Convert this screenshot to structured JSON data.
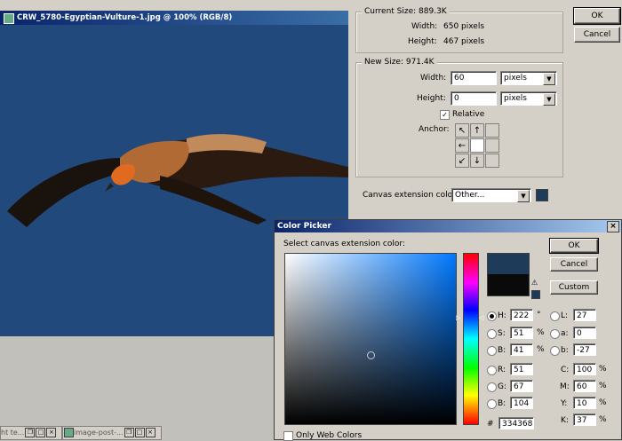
{
  "image_window": {
    "title": "CRW_5780-Egyptian-Vulture-1.jpg @ 100% (RGB/8)"
  },
  "canvas_size": {
    "current_size": "Current Size: 889.3K",
    "width_label": "Width:",
    "width_value": "650 pixels",
    "height_label": "Height:",
    "height_value": "467 pixels",
    "new_size": "New Size: 971.4K",
    "new_width": "60",
    "new_height": "0",
    "width_unit": "pixels",
    "height_unit": "pixels",
    "relative_label": "Relative",
    "relative_checked": true,
    "anchor_label": "Anchor:",
    "ext_color_label": "Canvas extension color:",
    "ext_color_value": "Other...",
    "ext_color_swatch": "#1f3b5a",
    "ok": "OK",
    "cancel": "Cancel"
  },
  "color_picker": {
    "title": "Color Picker",
    "prompt": "Select canvas extension color:",
    "ok": "OK",
    "cancel": "Cancel",
    "custom": "Custom",
    "new_color": "#1f3b5a",
    "old_color": "#0a0a0a",
    "H": {
      "label": "H:",
      "value": "222",
      "unit": "°"
    },
    "S": {
      "label": "S:",
      "value": "51",
      "unit": "%"
    },
    "Bv": {
      "label": "B:",
      "value": "41",
      "unit": "%"
    },
    "R": {
      "label": "R:",
      "value": "51"
    },
    "G": {
      "label": "G:",
      "value": "67"
    },
    "Bc": {
      "label": "B:",
      "value": "104"
    },
    "L": {
      "label": "L:",
      "value": "27"
    },
    "a": {
      "label": "a:",
      "value": "0"
    },
    "b": {
      "label": "b:",
      "value": "-27"
    },
    "C": {
      "label": "C:",
      "value": "100",
      "unit": "%"
    },
    "M": {
      "label": "M:",
      "value": "60",
      "unit": "%"
    },
    "Y": {
      "label": "Y:",
      "value": "10",
      "unit": "%"
    },
    "K": {
      "label": "K:",
      "value": "37",
      "unit": "%"
    },
    "hex_label": "#",
    "hex": "334368",
    "web_colors_label": "Only Web Colors"
  },
  "taskbar": {
    "item1": "ht te...",
    "item2": "image-post-..."
  }
}
